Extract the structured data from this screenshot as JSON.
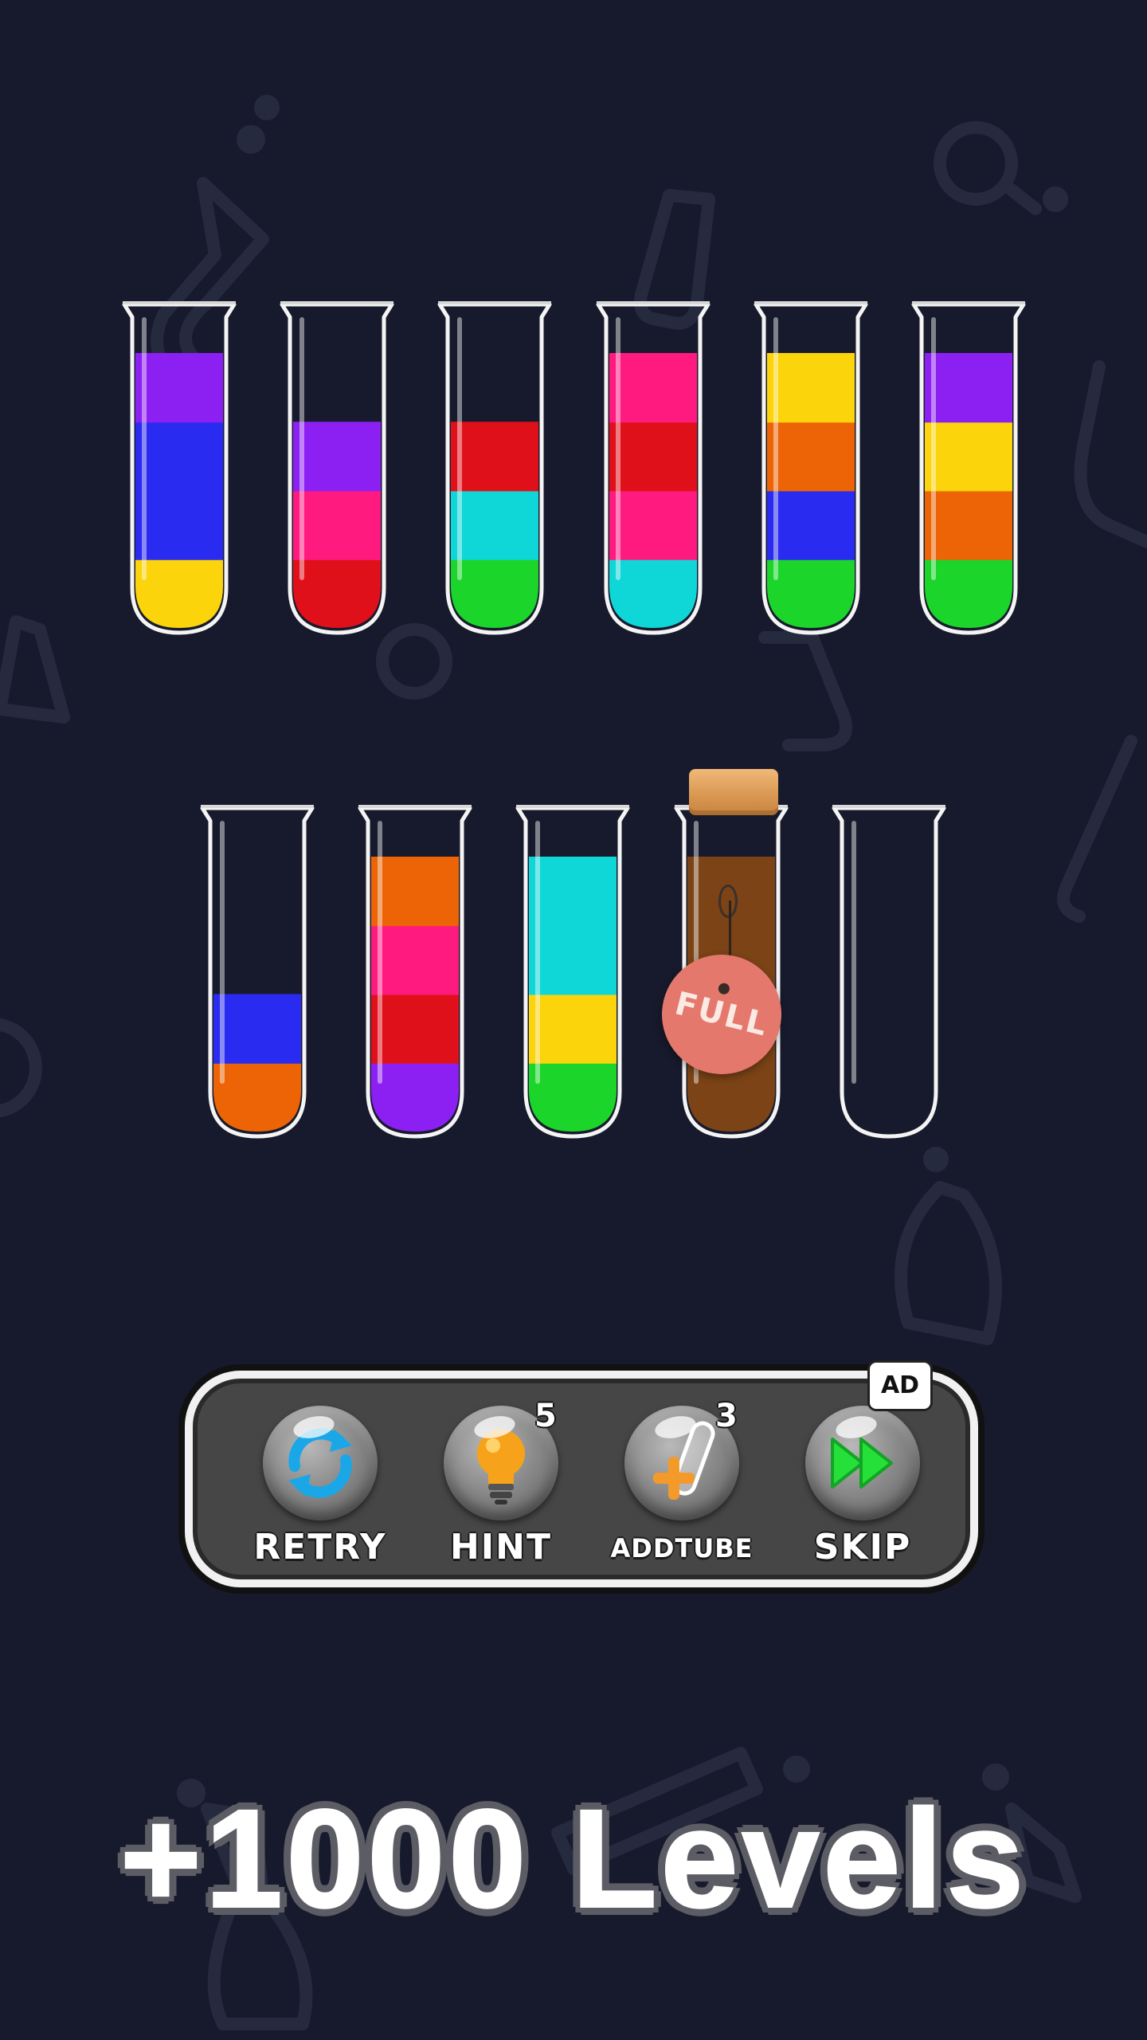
{
  "game": {
    "colors": {
      "purple": "#8c1ff2",
      "blue": "#2a2bf0",
      "yellow": "#fbd40b",
      "pink": "#ff1a80",
      "red": "#e0101a",
      "cyan": "#0fd7d8",
      "green": "#1bd52a",
      "orange": "#ec6405",
      "brown": "#7b4316"
    },
    "tube_capacity": 4,
    "rows": [
      [
        {
          "id": "tube-1",
          "layers": [
            "yellow",
            "blue",
            "blue",
            "purple"
          ]
        },
        {
          "id": "tube-2",
          "layers": [
            "red",
            "pink",
            "purple"
          ]
        },
        {
          "id": "tube-3",
          "layers": [
            "green",
            "cyan",
            "red"
          ]
        },
        {
          "id": "tube-4",
          "layers": [
            "cyan",
            "pink",
            "red",
            "pink"
          ]
        },
        {
          "id": "tube-5",
          "layers": [
            "green",
            "blue",
            "orange",
            "yellow"
          ]
        },
        {
          "id": "tube-6",
          "layers": [
            "green",
            "orange",
            "yellow",
            "purple"
          ]
        }
      ],
      [
        {
          "id": "tube-7",
          "layers": [
            "orange",
            "blue"
          ]
        },
        {
          "id": "tube-8",
          "layers": [
            "purple",
            "red",
            "pink",
            "orange"
          ]
        },
        {
          "id": "tube-9",
          "layers": [
            "green",
            "yellow",
            "cyan",
            "cyan"
          ]
        },
        {
          "id": "tube-10",
          "layers": [
            "brown",
            "brown",
            "brown",
            "brown"
          ],
          "sealed": true,
          "tag": "FULL"
        },
        {
          "id": "tube-11",
          "layers": []
        }
      ]
    ]
  },
  "toolbar": {
    "retry": {
      "label": "RETRY",
      "icon": "refresh-icon"
    },
    "hint": {
      "label": "HINT",
      "count": "5",
      "icon": "lightbulb-icon"
    },
    "addtube": {
      "label": "ADDTUBE",
      "count": "3",
      "icon": "add-tube-icon"
    },
    "skip": {
      "label": "SKIP",
      "badge": "AD",
      "icon": "fast-forward-icon"
    }
  },
  "promo": {
    "text": "+1000 Levels"
  }
}
